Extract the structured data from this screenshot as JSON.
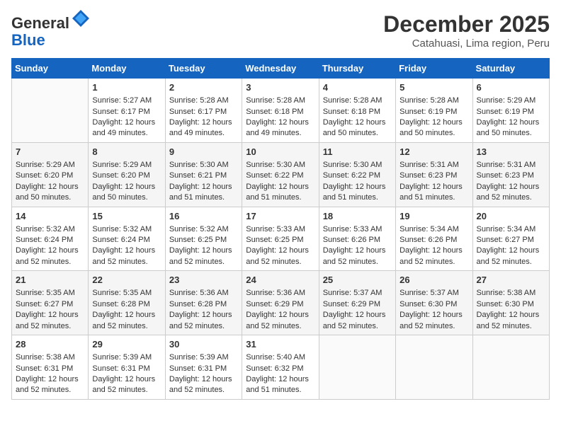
{
  "header": {
    "logo_line1": "General",
    "logo_line2": "Blue",
    "month_title": "December 2025",
    "subtitle": "Catahuasi, Lima region, Peru"
  },
  "days_of_week": [
    "Sunday",
    "Monday",
    "Tuesday",
    "Wednesday",
    "Thursday",
    "Friday",
    "Saturday"
  ],
  "weeks": [
    [
      {
        "day": "",
        "content": ""
      },
      {
        "day": "1",
        "content": "Sunrise: 5:27 AM\nSunset: 6:17 PM\nDaylight: 12 hours\nand 49 minutes."
      },
      {
        "day": "2",
        "content": "Sunrise: 5:28 AM\nSunset: 6:17 PM\nDaylight: 12 hours\nand 49 minutes."
      },
      {
        "day": "3",
        "content": "Sunrise: 5:28 AM\nSunset: 6:18 PM\nDaylight: 12 hours\nand 49 minutes."
      },
      {
        "day": "4",
        "content": "Sunrise: 5:28 AM\nSunset: 6:18 PM\nDaylight: 12 hours\nand 50 minutes."
      },
      {
        "day": "5",
        "content": "Sunrise: 5:28 AM\nSunset: 6:19 PM\nDaylight: 12 hours\nand 50 minutes."
      },
      {
        "day": "6",
        "content": "Sunrise: 5:29 AM\nSunset: 6:19 PM\nDaylight: 12 hours\nand 50 minutes."
      }
    ],
    [
      {
        "day": "7",
        "content": "Sunrise: 5:29 AM\nSunset: 6:20 PM\nDaylight: 12 hours\nand 50 minutes."
      },
      {
        "day": "8",
        "content": "Sunrise: 5:29 AM\nSunset: 6:20 PM\nDaylight: 12 hours\nand 50 minutes."
      },
      {
        "day": "9",
        "content": "Sunrise: 5:30 AM\nSunset: 6:21 PM\nDaylight: 12 hours\nand 51 minutes."
      },
      {
        "day": "10",
        "content": "Sunrise: 5:30 AM\nSunset: 6:22 PM\nDaylight: 12 hours\nand 51 minutes."
      },
      {
        "day": "11",
        "content": "Sunrise: 5:30 AM\nSunset: 6:22 PM\nDaylight: 12 hours\nand 51 minutes."
      },
      {
        "day": "12",
        "content": "Sunrise: 5:31 AM\nSunset: 6:23 PM\nDaylight: 12 hours\nand 51 minutes."
      },
      {
        "day": "13",
        "content": "Sunrise: 5:31 AM\nSunset: 6:23 PM\nDaylight: 12 hours\nand 52 minutes."
      }
    ],
    [
      {
        "day": "14",
        "content": "Sunrise: 5:32 AM\nSunset: 6:24 PM\nDaylight: 12 hours\nand 52 minutes."
      },
      {
        "day": "15",
        "content": "Sunrise: 5:32 AM\nSunset: 6:24 PM\nDaylight: 12 hours\nand 52 minutes."
      },
      {
        "day": "16",
        "content": "Sunrise: 5:32 AM\nSunset: 6:25 PM\nDaylight: 12 hours\nand 52 minutes."
      },
      {
        "day": "17",
        "content": "Sunrise: 5:33 AM\nSunset: 6:25 PM\nDaylight: 12 hours\nand 52 minutes."
      },
      {
        "day": "18",
        "content": "Sunrise: 5:33 AM\nSunset: 6:26 PM\nDaylight: 12 hours\nand 52 minutes."
      },
      {
        "day": "19",
        "content": "Sunrise: 5:34 AM\nSunset: 6:26 PM\nDaylight: 12 hours\nand 52 minutes."
      },
      {
        "day": "20",
        "content": "Sunrise: 5:34 AM\nSunset: 6:27 PM\nDaylight: 12 hours\nand 52 minutes."
      }
    ],
    [
      {
        "day": "21",
        "content": "Sunrise: 5:35 AM\nSunset: 6:27 PM\nDaylight: 12 hours\nand 52 minutes."
      },
      {
        "day": "22",
        "content": "Sunrise: 5:35 AM\nSunset: 6:28 PM\nDaylight: 12 hours\nand 52 minutes."
      },
      {
        "day": "23",
        "content": "Sunrise: 5:36 AM\nSunset: 6:28 PM\nDaylight: 12 hours\nand 52 minutes."
      },
      {
        "day": "24",
        "content": "Sunrise: 5:36 AM\nSunset: 6:29 PM\nDaylight: 12 hours\nand 52 minutes."
      },
      {
        "day": "25",
        "content": "Sunrise: 5:37 AM\nSunset: 6:29 PM\nDaylight: 12 hours\nand 52 minutes."
      },
      {
        "day": "26",
        "content": "Sunrise: 5:37 AM\nSunset: 6:30 PM\nDaylight: 12 hours\nand 52 minutes."
      },
      {
        "day": "27",
        "content": "Sunrise: 5:38 AM\nSunset: 6:30 PM\nDaylight: 12 hours\nand 52 minutes."
      }
    ],
    [
      {
        "day": "28",
        "content": "Sunrise: 5:38 AM\nSunset: 6:31 PM\nDaylight: 12 hours\nand 52 minutes."
      },
      {
        "day": "29",
        "content": "Sunrise: 5:39 AM\nSunset: 6:31 PM\nDaylight: 12 hours\nand 52 minutes."
      },
      {
        "day": "30",
        "content": "Sunrise: 5:39 AM\nSunset: 6:31 PM\nDaylight: 12 hours\nand 52 minutes."
      },
      {
        "day": "31",
        "content": "Sunrise: 5:40 AM\nSunset: 6:32 PM\nDaylight: 12 hours\nand 51 minutes."
      },
      {
        "day": "",
        "content": ""
      },
      {
        "day": "",
        "content": ""
      },
      {
        "day": "",
        "content": ""
      }
    ]
  ]
}
